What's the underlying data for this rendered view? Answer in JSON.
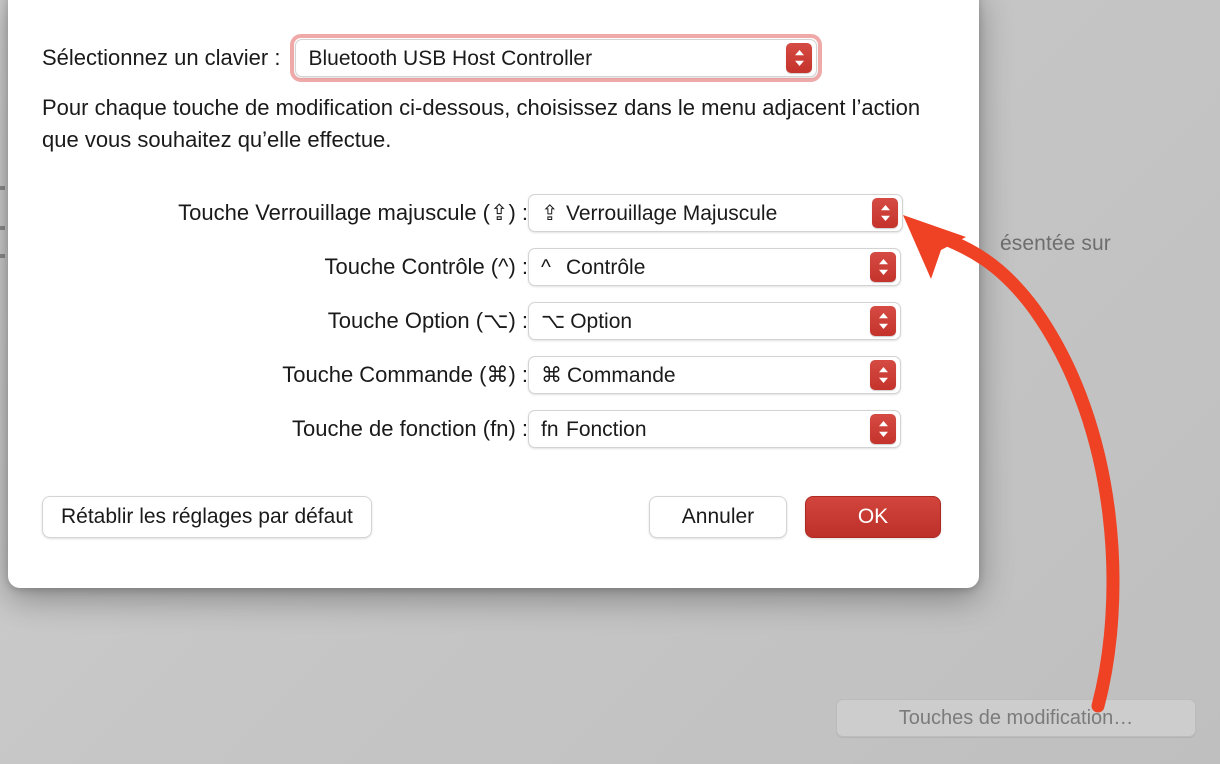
{
  "background": {
    "partial_text": "ésentée sur",
    "modifier_keys_button_label": "Touches de modification…"
  },
  "dialog": {
    "keyboard_selector": {
      "label": "Sélectionnez un clavier :",
      "value": "Bluetooth USB Host Controller",
      "focused": true
    },
    "instructions": "Pour chaque touche de modification ci-dessous, choisissez dans le menu adjacent l’action que vous souhaitez qu’elle effectue.",
    "modifier_rows": [
      {
        "label": "Touche Verrouillage majuscule (⇪) :",
        "value_glyph": "⇪",
        "value_text": "Verrouillage Majuscule"
      },
      {
        "label": "Touche Contrôle (^) :",
        "value_glyph": "^",
        "value_text": "Contrôle"
      },
      {
        "label": "Touche Option (⌥) :",
        "value_glyph": "⌥",
        "value_text": "Option"
      },
      {
        "label": "Touche Commande (⌘) :",
        "value_glyph": "⌘",
        "value_text": "Commande"
      },
      {
        "label": "Touche de fonction (fn) :",
        "value_glyph": "fn",
        "value_text": "Fonction"
      }
    ],
    "buttons": {
      "reset": "Rétablir les réglages par défaut",
      "cancel": "Annuler",
      "ok": "OK"
    }
  },
  "colors": {
    "accent_red": "#c4332c",
    "annotation_red": "#ef4123",
    "focus_ring": "#efa9a9",
    "window_background": "#c6c6c6"
  }
}
